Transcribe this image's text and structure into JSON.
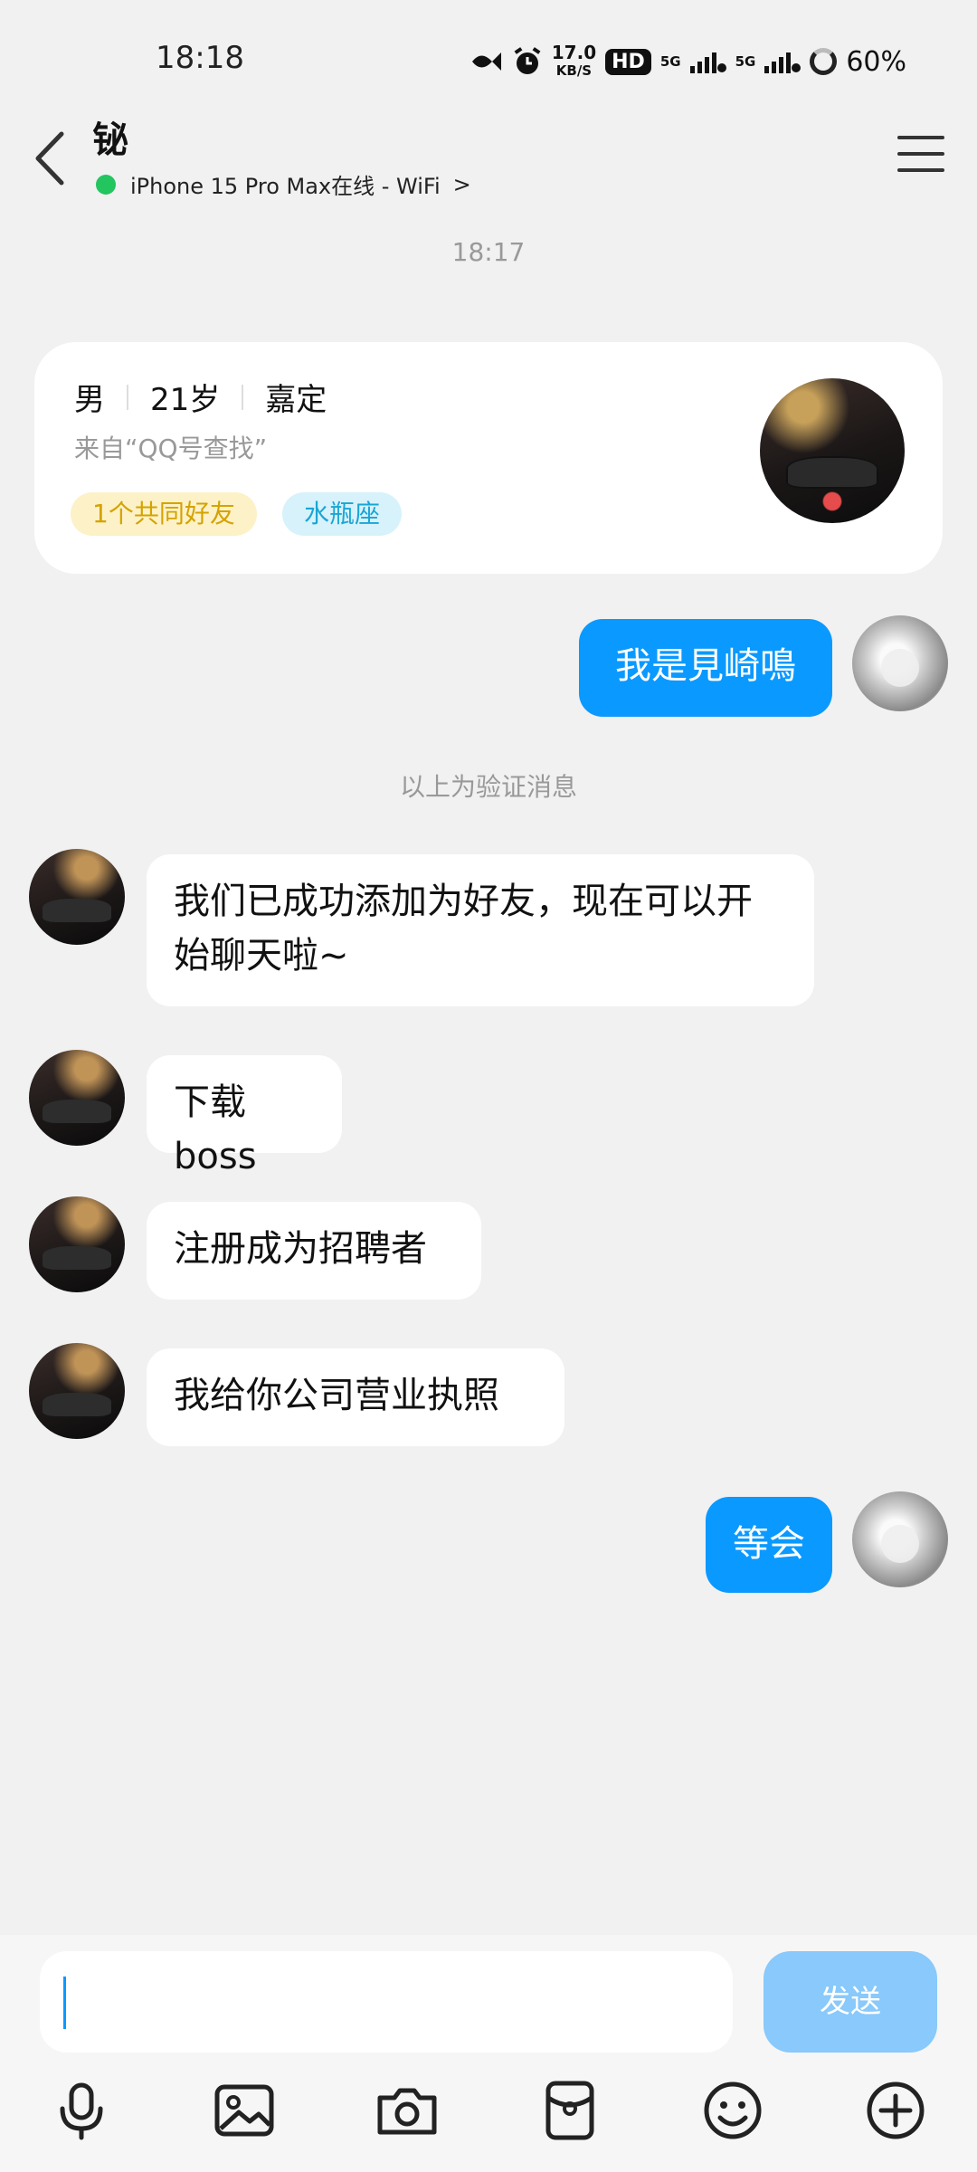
{
  "status_bar": {
    "time": "18:18",
    "net_speed_value": "17.0",
    "net_speed_unit": "KB/S",
    "hd": "HD",
    "sim1": "5G",
    "sim2": "5G",
    "battery": "60%"
  },
  "header": {
    "title": "铋",
    "online_status": "iPhone 15 Pro Max在线 - WiFi",
    "chevron": ">"
  },
  "chat_time": "18:17",
  "profile_card": {
    "gender": "男",
    "age": "21岁",
    "location": "嘉定",
    "source": "来自“QQ号查找”",
    "tag_mutual_friends": "1个共同好友",
    "tag_zodiac": "水瓶座"
  },
  "messages": [
    {
      "side": "right",
      "text": "我是見崎鳴"
    },
    {
      "side": "left",
      "text": "我们已成功添加为好友，现在可以开始聊天啦~"
    },
    {
      "side": "left",
      "text": "下载boss"
    },
    {
      "side": "left",
      "text": "注册成为招聘者"
    },
    {
      "side": "left",
      "text": "我给你公司营业执照"
    },
    {
      "side": "right",
      "text": "等会"
    }
  ],
  "system_message": "以上为验证消息",
  "input": {
    "send_label": "发送"
  },
  "toolbar": [
    "microphone-icon",
    "image-icon",
    "camera-icon",
    "red-packet-icon",
    "emoji-icon",
    "plus-icon"
  ],
  "colors": {
    "accent": "#0a99ff",
    "send_disabled": "#89c9fb",
    "online_dot": "#22c55e"
  }
}
